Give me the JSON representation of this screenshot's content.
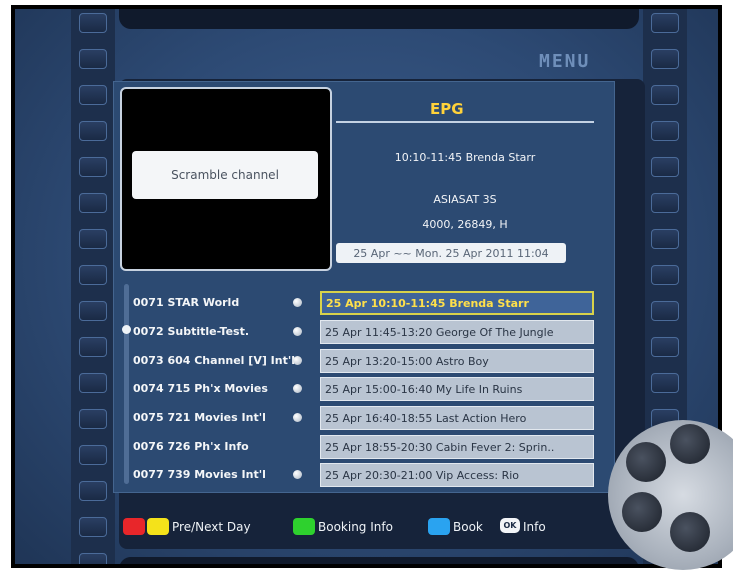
{
  "header": {
    "menu_label": "MENU"
  },
  "preview": {
    "message": "Scramble channel"
  },
  "epg": {
    "title": "EPG",
    "current_program": "10:10-11:45 Brenda Starr",
    "satellite": "ASIASAT 3S",
    "transponder": "4000, 26849, H",
    "date_range": "25 Apr ~~ Mon. 25 Apr 2011 11:04"
  },
  "channels": [
    {
      "label": "0071 STAR World",
      "has_event": true
    },
    {
      "label": "0072 Subtitle-Test.",
      "has_event": true
    },
    {
      "label": "0073 604 Channel [V] Int'l",
      "has_event": true
    },
    {
      "label": "0074 715 Ph'x Movies",
      "has_event": true
    },
    {
      "label": "0075 721 Movies Int'l",
      "has_event": true
    },
    {
      "label": "0076 726 Ph'x Info",
      "has_event": false
    },
    {
      "label": "0077 739 Movies Int'l",
      "has_event": true
    }
  ],
  "events": [
    {
      "label": "25 Apr 10:10-11:45  Brenda Starr",
      "selected": true
    },
    {
      "label": "25 Apr 11:45-13:20  George Of The Jungle",
      "selected": false
    },
    {
      "label": "25 Apr 13:20-15:00  Astro Boy",
      "selected": false
    },
    {
      "label": "25 Apr 15:00-16:40  My Life In Ruins",
      "selected": false
    },
    {
      "label": "25 Apr 16:40-18:55  Last Action Hero",
      "selected": false
    },
    {
      "label": "25 Apr 18:55-20:30  Cabin Fever 2: Sprin..",
      "selected": false
    },
    {
      "label": "25 Apr 20:30-21:00  Vip Access: Rio",
      "selected": false
    }
  ],
  "legend": {
    "pre_next_day": "Pre/Next Day",
    "booking_info": "Booking Info",
    "book": "Book",
    "ok_key": "OK",
    "info": "Info"
  },
  "colors": {
    "red": "#e8262a",
    "yellow": "#f4e21a",
    "green": "#2ed12e",
    "blue": "#2aa3f0",
    "selection_text": "#ffe04a",
    "epg_title": "#ffd23a"
  }
}
